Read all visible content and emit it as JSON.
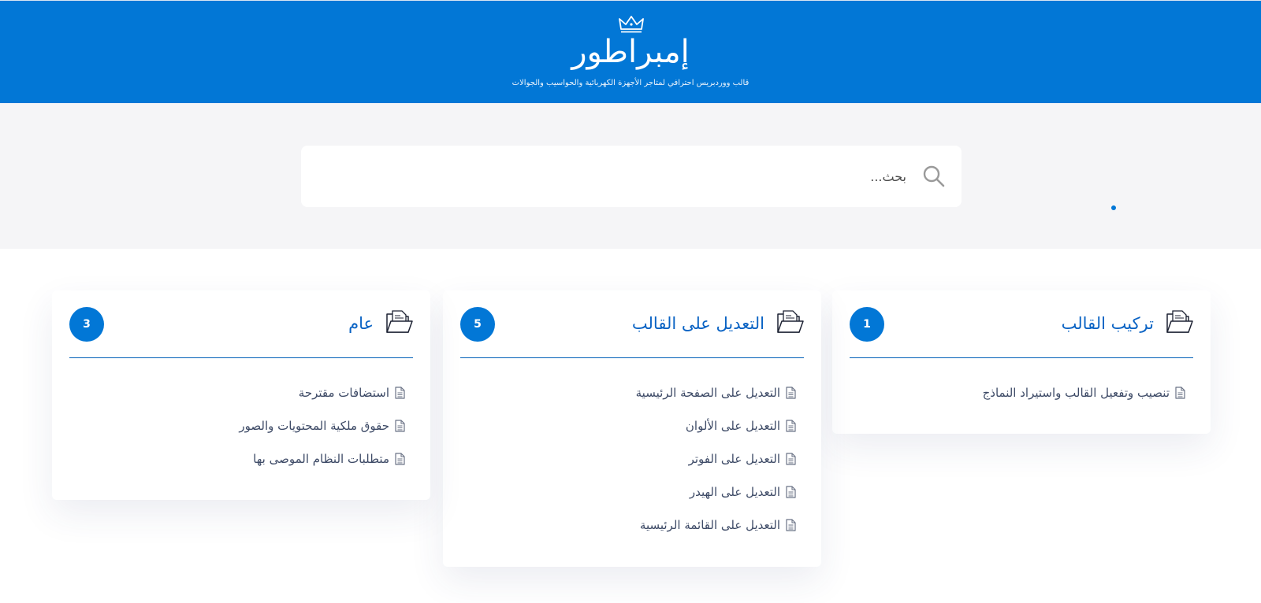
{
  "header": {
    "title": "إمبراطور",
    "tagline": "قالب ووردبريس احترافي لمتاجر الأجهزة الكهربائية والحواسيب والجوالات",
    "logo_icon": "crown-icon"
  },
  "search": {
    "placeholder": "بحث...",
    "value": "",
    "icon": "search-icon"
  },
  "colors": {
    "brand": "#0277d6",
    "title_blue": "#0a63c4",
    "background_band": "#f5f5f7",
    "text": "#3d4a66"
  },
  "categories": [
    {
      "title": "تركيب القالب",
      "count": "1",
      "icon": "folder-icon",
      "articles": [
        "تنصيب وتفعيل القالب واستيراد النماذج"
      ]
    },
    {
      "title": "التعديل على القالب",
      "count": "5",
      "icon": "folder-icon",
      "articles": [
        "التعديل على الصفحة الرئيسية",
        "التعديل على الألوان",
        "التعديل على الفوتر",
        "التعديل على الهيدر",
        "التعديل على القائمة الرئيسية"
      ]
    },
    {
      "title": "عام",
      "count": "3",
      "icon": "folder-icon",
      "articles": [
        "استضافات مقترحة",
        "حقوق ملكية المحتويات والصور",
        "متطلبات النظام الموصى بها"
      ]
    }
  ]
}
